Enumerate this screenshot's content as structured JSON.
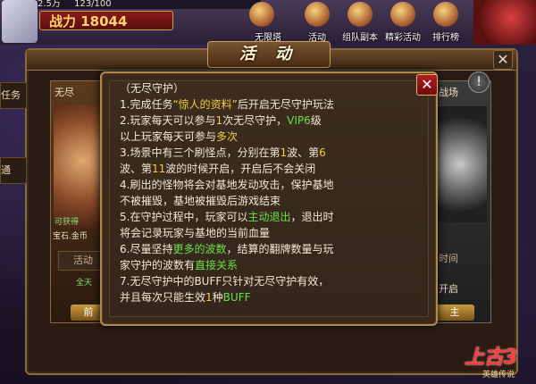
{
  "hud": {
    "res1": "2.5万",
    "res2": "123/100",
    "power_label": "战力 18044",
    "menu": [
      {
        "label": "无限塔"
      },
      {
        "label": "活动"
      },
      {
        "label": "组队副本"
      },
      {
        "label": "精彩活动"
      },
      {
        "label": "排行榜"
      }
    ]
  },
  "activity": {
    "title": "活 动",
    "close": "✕",
    "left_tabs": [
      "任务",
      "通"
    ],
    "left_card": {
      "caption": "无尽",
      "reward_label": "可获得",
      "reward": "宝石.金币",
      "button": "活动",
      "sub": "全天",
      "action": "前"
    },
    "right_card": {
      "caption": "战场",
      "time": "时间",
      "open": "开启",
      "action": "主"
    },
    "info": "!"
  },
  "rules": {
    "close": "✕",
    "lines": [
      [
        {
          "t": "（无尽守护）"
        }
      ],
      [
        {
          "t": "1.完成任务"
        },
        {
          "t": "“惊人的资料”",
          "c": "y"
        },
        {
          "t": "后开启无尽守护玩法"
        }
      ],
      [
        {
          "t": "2.玩家每天可以参与"
        },
        {
          "t": "1",
          "c": "y"
        },
        {
          "t": "次无尽守护，"
        },
        {
          "t": "VIP6",
          "c": "g"
        },
        {
          "t": "级"
        }
      ],
      [
        {
          "t": "   以上玩家每天可参与"
        },
        {
          "t": "多次",
          "c": "y"
        }
      ],
      [
        {
          "t": "3.场景中有三个刷怪点，分别在第"
        },
        {
          "t": "1",
          "c": "y"
        },
        {
          "t": "波、第"
        },
        {
          "t": "6",
          "c": "y"
        }
      ],
      [
        {
          "t": "   波、第"
        },
        {
          "t": "11",
          "c": "y"
        },
        {
          "t": "波的时候开启，开启后不会关闭"
        }
      ],
      [
        {
          "t": "4.刷出的怪物将会对基地发动攻击，保护基地"
        }
      ],
      [
        {
          "t": "   不被摧毁，基地被摧毁后游戏结束"
        }
      ],
      [
        {
          "t": "5.在守护过程中，玩家可以"
        },
        {
          "t": "主动退出",
          "c": "g"
        },
        {
          "t": "，退出时"
        }
      ],
      [
        {
          "t": "   将会记录玩家与基地的当前血量"
        }
      ],
      [
        {
          "t": "6.尽量坚持"
        },
        {
          "t": "更多的波数",
          "c": "g"
        },
        {
          "t": "，结算的翻牌数量与玩"
        }
      ],
      [
        {
          "t": "   家守护的波数有"
        },
        {
          "t": "直接关系",
          "c": "g"
        }
      ],
      [
        {
          "t": "7.无尽守护中的BUFF只针对无尽守护有效，"
        }
      ],
      [
        {
          "t": "   并且每次只能生效"
        },
        {
          "t": "1",
          "c": "y"
        },
        {
          "t": "种"
        },
        {
          "t": "BUFF",
          "c": "g"
        }
      ]
    ]
  },
  "logo": {
    "main": "上古3",
    "sub": "英雄传说"
  }
}
